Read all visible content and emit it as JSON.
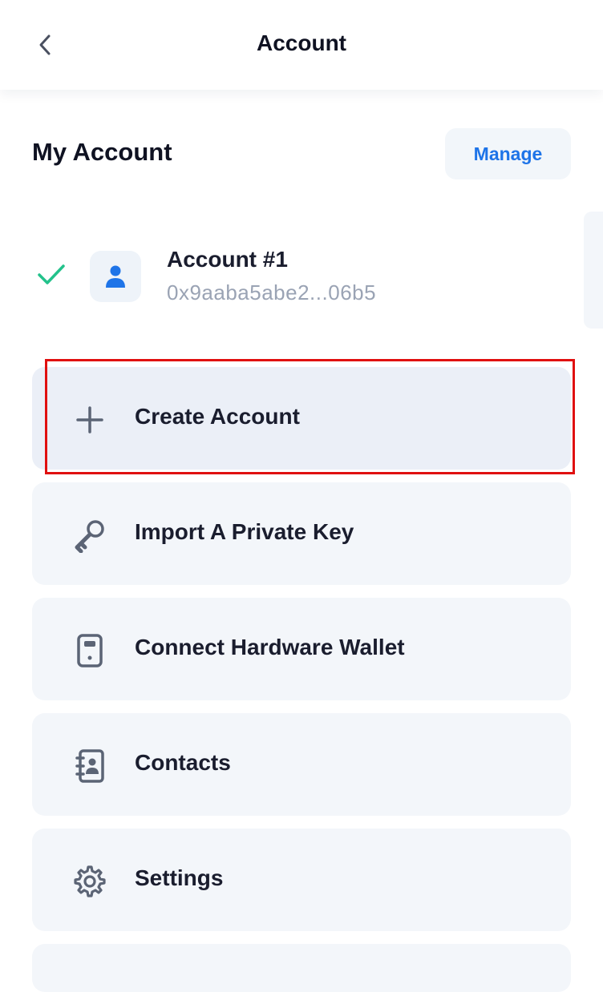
{
  "header": {
    "title": "Account",
    "back_icon": "chevron-left-icon"
  },
  "my_account": {
    "title": "My Account",
    "manage_label": "Manage"
  },
  "accounts": [
    {
      "name": "Account #1",
      "address": "0x9aaba5abe2...06b5",
      "selected": true,
      "icon": "user-icon"
    }
  ],
  "menu": [
    {
      "label": "Create Account",
      "icon": "plus-icon"
    },
    {
      "label": "Import A Private Key",
      "icon": "key-icon"
    },
    {
      "label": "Connect Hardware Wallet",
      "icon": "hardware-wallet-icon"
    },
    {
      "label": "Contacts",
      "icon": "contacts-icon"
    },
    {
      "label": "Settings",
      "icon": "gear-icon"
    }
  ],
  "colors": {
    "accent": "#1e74e8",
    "check": "#23c28b",
    "highlight": "#e01010",
    "text_primary": "#1a1d2e",
    "text_secondary": "#9aa3b4",
    "card_bg": "#f3f6fa",
    "icon": "#5b6475"
  }
}
